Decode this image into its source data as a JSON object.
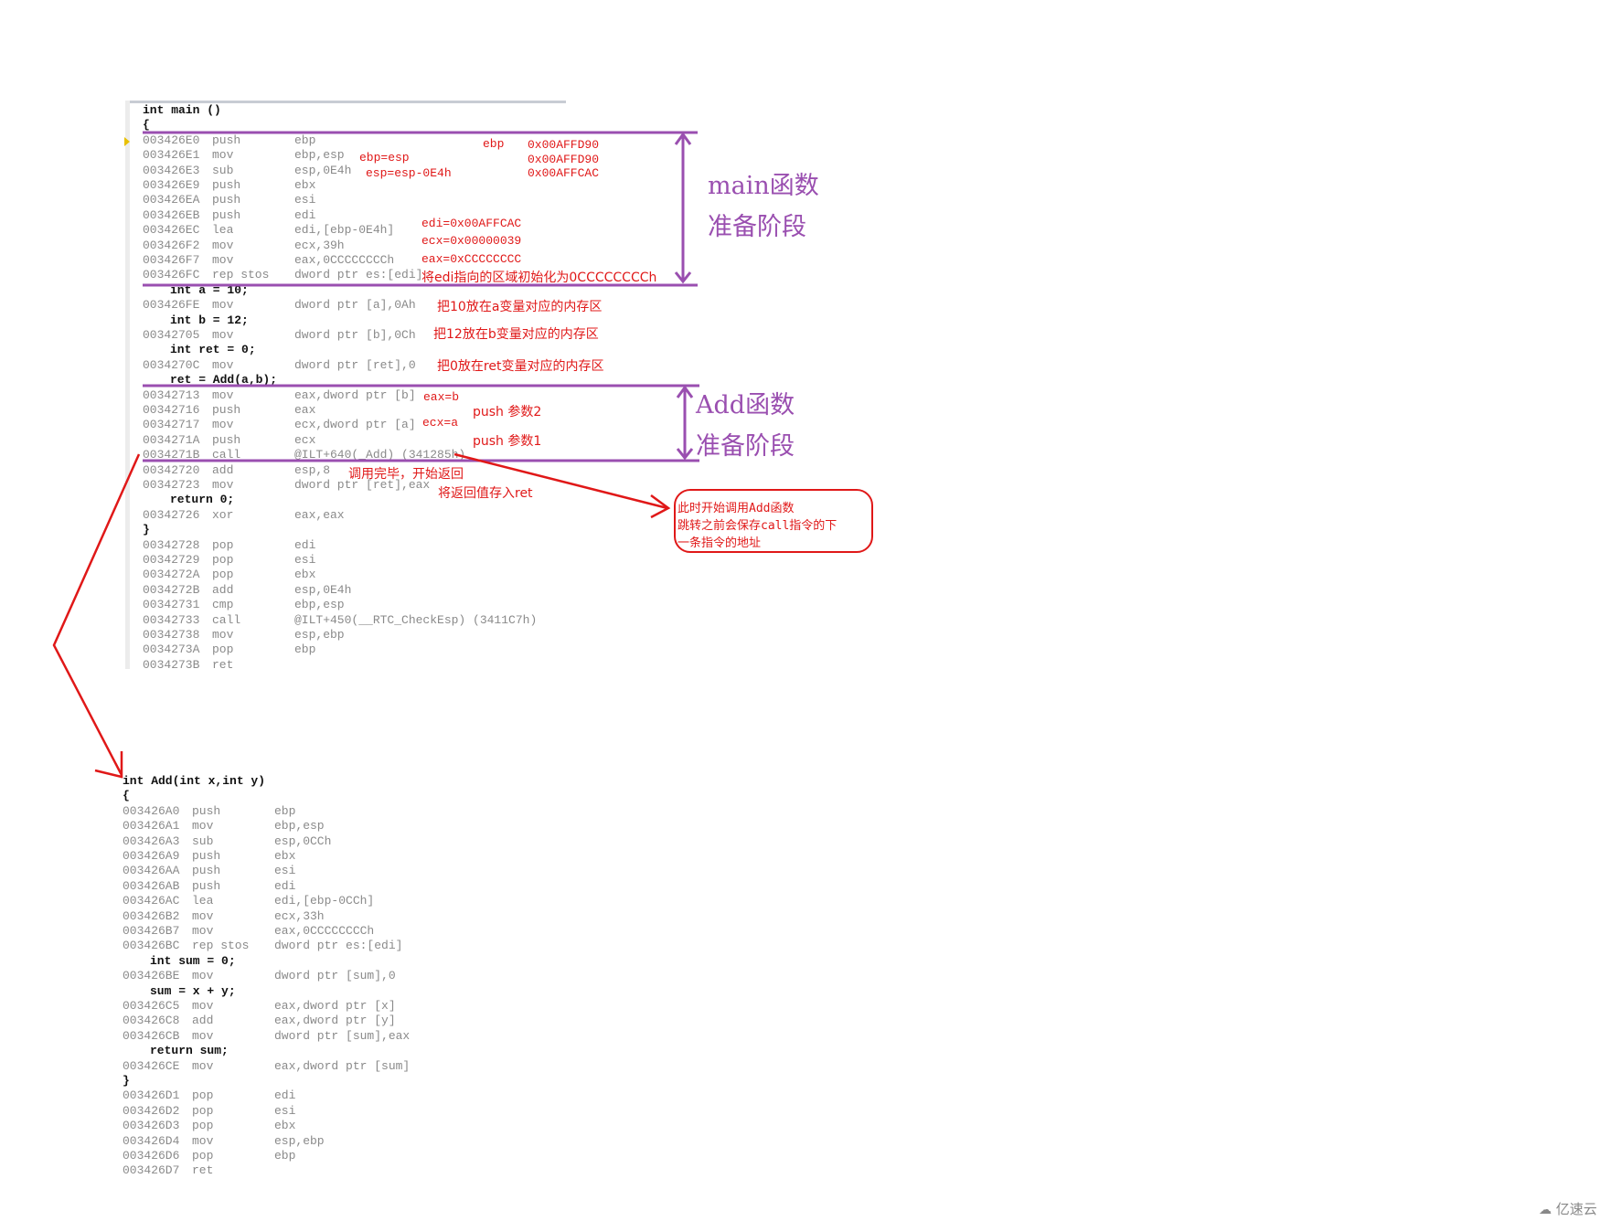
{
  "main_code": [
    {
      "src": "int main ()",
      "indent": false
    },
    {
      "src": "{",
      "indent": false
    },
    {
      "addr": "003426E0",
      "mn": "push",
      "op": "ebp"
    },
    {
      "addr": "003426E1",
      "mn": "mov",
      "op": "ebp,esp"
    },
    {
      "addr": "003426E3",
      "mn": "sub",
      "op": "esp,0E4h"
    },
    {
      "addr": "003426E9",
      "mn": "push",
      "op": "ebx"
    },
    {
      "addr": "003426EA",
      "mn": "push",
      "op": "esi"
    },
    {
      "addr": "003426EB",
      "mn": "push",
      "op": "edi"
    },
    {
      "addr": "003426EC",
      "mn": "lea",
      "op": "edi,[ebp-0E4h]"
    },
    {
      "addr": "003426F2",
      "mn": "mov",
      "op": "ecx,39h"
    },
    {
      "addr": "003426F7",
      "mn": "mov",
      "op": "eax,0CCCCCCCCh"
    },
    {
      "addr": "003426FC",
      "mn": "rep stos",
      "op": "dword ptr es:[edi]"
    },
    {
      "src": "int a = 10;",
      "indent": true
    },
    {
      "addr": "003426FE",
      "mn": "mov",
      "op": "dword ptr [a],0Ah"
    },
    {
      "src": "int b = 12;",
      "indent": true
    },
    {
      "addr": "00342705",
      "mn": "mov",
      "op": "dword ptr [b],0Ch"
    },
    {
      "src": "int ret = 0;",
      "indent": true
    },
    {
      "addr": "0034270C",
      "mn": "mov",
      "op": "dword ptr [ret],0"
    },
    {
      "src": "ret = Add(a,b);",
      "indent": true
    },
    {
      "addr": "00342713",
      "mn": "mov",
      "op": "eax,dword ptr [b]"
    },
    {
      "addr": "00342716",
      "mn": "push",
      "op": "eax"
    },
    {
      "addr": "00342717",
      "mn": "mov",
      "op": "ecx,dword ptr [a]"
    },
    {
      "addr": "0034271A",
      "mn": "push",
      "op": "ecx"
    },
    {
      "addr": "0034271B",
      "mn": "call",
      "op": "@ILT+640(_Add) (341285h)"
    },
    {
      "addr": "00342720",
      "mn": "add",
      "op": "esp,8"
    },
    {
      "addr": "00342723",
      "mn": "mov",
      "op": "dword ptr [ret],eax"
    },
    {
      "src": "return 0;",
      "indent": true
    },
    {
      "addr": "00342726",
      "mn": "xor",
      "op": "eax,eax"
    },
    {
      "src": "}",
      "indent": false
    },
    {
      "addr": "00342728",
      "mn": "pop",
      "op": "edi"
    },
    {
      "addr": "00342729",
      "mn": "pop",
      "op": "esi"
    },
    {
      "addr": "0034272A",
      "mn": "pop",
      "op": "ebx"
    },
    {
      "addr": "0034272B",
      "mn": "add",
      "op": "esp,0E4h"
    },
    {
      "addr": "00342731",
      "mn": "cmp",
      "op": "ebp,esp"
    },
    {
      "addr": "00342733",
      "mn": "call",
      "op": "@ILT+450(__RTC_CheckEsp) (3411C7h)"
    },
    {
      "addr": "00342738",
      "mn": "mov",
      "op": "esp,ebp"
    },
    {
      "addr": "0034273A",
      "mn": "pop",
      "op": "ebp"
    },
    {
      "addr": "0034273B",
      "mn": "ret",
      "op": ""
    }
  ],
  "add_code": [
    {
      "src": "int Add(int x,int y)",
      "indent": false
    },
    {
      "src": "{",
      "indent": false
    },
    {
      "addr": "003426A0",
      "mn": "push",
      "op": "ebp"
    },
    {
      "addr": "003426A1",
      "mn": "mov",
      "op": "ebp,esp"
    },
    {
      "addr": "003426A3",
      "mn": "sub",
      "op": "esp,0CCh"
    },
    {
      "addr": "003426A9",
      "mn": "push",
      "op": "ebx"
    },
    {
      "addr": "003426AA",
      "mn": "push",
      "op": "esi"
    },
    {
      "addr": "003426AB",
      "mn": "push",
      "op": "edi"
    },
    {
      "addr": "003426AC",
      "mn": "lea",
      "op": "edi,[ebp-0CCh]"
    },
    {
      "addr": "003426B2",
      "mn": "mov",
      "op": "ecx,33h"
    },
    {
      "addr": "003426B7",
      "mn": "mov",
      "op": "eax,0CCCCCCCCh"
    },
    {
      "addr": "003426BC",
      "mn": "rep stos",
      "op": "dword ptr es:[edi]"
    },
    {
      "src": "int sum = 0;",
      "indent": true
    },
    {
      "addr": "003426BE",
      "mn": "mov",
      "op": "dword ptr [sum],0"
    },
    {
      "src": "sum = x + y;",
      "indent": true
    },
    {
      "addr": "003426C5",
      "mn": "mov",
      "op": "eax,dword ptr [x]"
    },
    {
      "addr": "003426C8",
      "mn": "add",
      "op": "eax,dword ptr [y]"
    },
    {
      "addr": "003426CB",
      "mn": "mov",
      "op": "dword ptr [sum],eax"
    },
    {
      "src": "return sum;",
      "indent": true
    },
    {
      "addr": "003426CE",
      "mn": "mov",
      "op": "eax,dword ptr [sum]"
    },
    {
      "src": "}",
      "indent": false
    },
    {
      "addr": "003426D1",
      "mn": "pop",
      "op": "edi"
    },
    {
      "addr": "003426D2",
      "mn": "pop",
      "op": "esi"
    },
    {
      "addr": "003426D3",
      "mn": "pop",
      "op": "ebx"
    },
    {
      "addr": "003426D4",
      "mn": "mov",
      "op": "esp,ebp"
    },
    {
      "addr": "003426D6",
      "mn": "pop",
      "op": "ebp"
    },
    {
      "addr": "003426D7",
      "mn": "ret",
      "op": ""
    }
  ],
  "notes": {
    "ebp_label": "ebp",
    "ebp_val1": "0x00AFFD90",
    "ebp_val2": "0x00AFFD90",
    "esp_val": "0x00AFFCAC",
    "ebp_eq_esp": "ebp=esp",
    "esp_sub": "esp=esp-0E4h",
    "edi_val": "edi=0x00AFFCAC",
    "ecx_val": "ecx=0x00000039",
    "eax_val": "eax=0xCCCCCCCC",
    "rep_stos": "将edi指向的区域初始化为0CCCCCCCCh",
    "store_a": "把10放在a变量对应的内存区",
    "store_b": "把12放在b变量对应的内存区",
    "store_ret": "把0放在ret变量对应的内存区",
    "eax_b": "eax=b",
    "push_arg2": "push 参数2",
    "ecx_a": "ecx=a",
    "push_arg1": "push 参数1",
    "call_done": "调用完毕，开始返回",
    "store_result": "将返回值存入ret"
  },
  "phases": {
    "main_line1": "main函数",
    "main_line2": "准备阶段",
    "add_line1": "Add函数",
    "add_line2": "准备阶段"
  },
  "callout": {
    "line1": "此时开始调用Add函数",
    "line2": "跳转之前会保存call指令的下",
    "line3": "一条指令的地址"
  },
  "watermark": "亿速云",
  "colors": {
    "annotation_red": "#e01818",
    "phase_purple": "#9a4fb0",
    "code_gray": "#8a8a8a"
  }
}
